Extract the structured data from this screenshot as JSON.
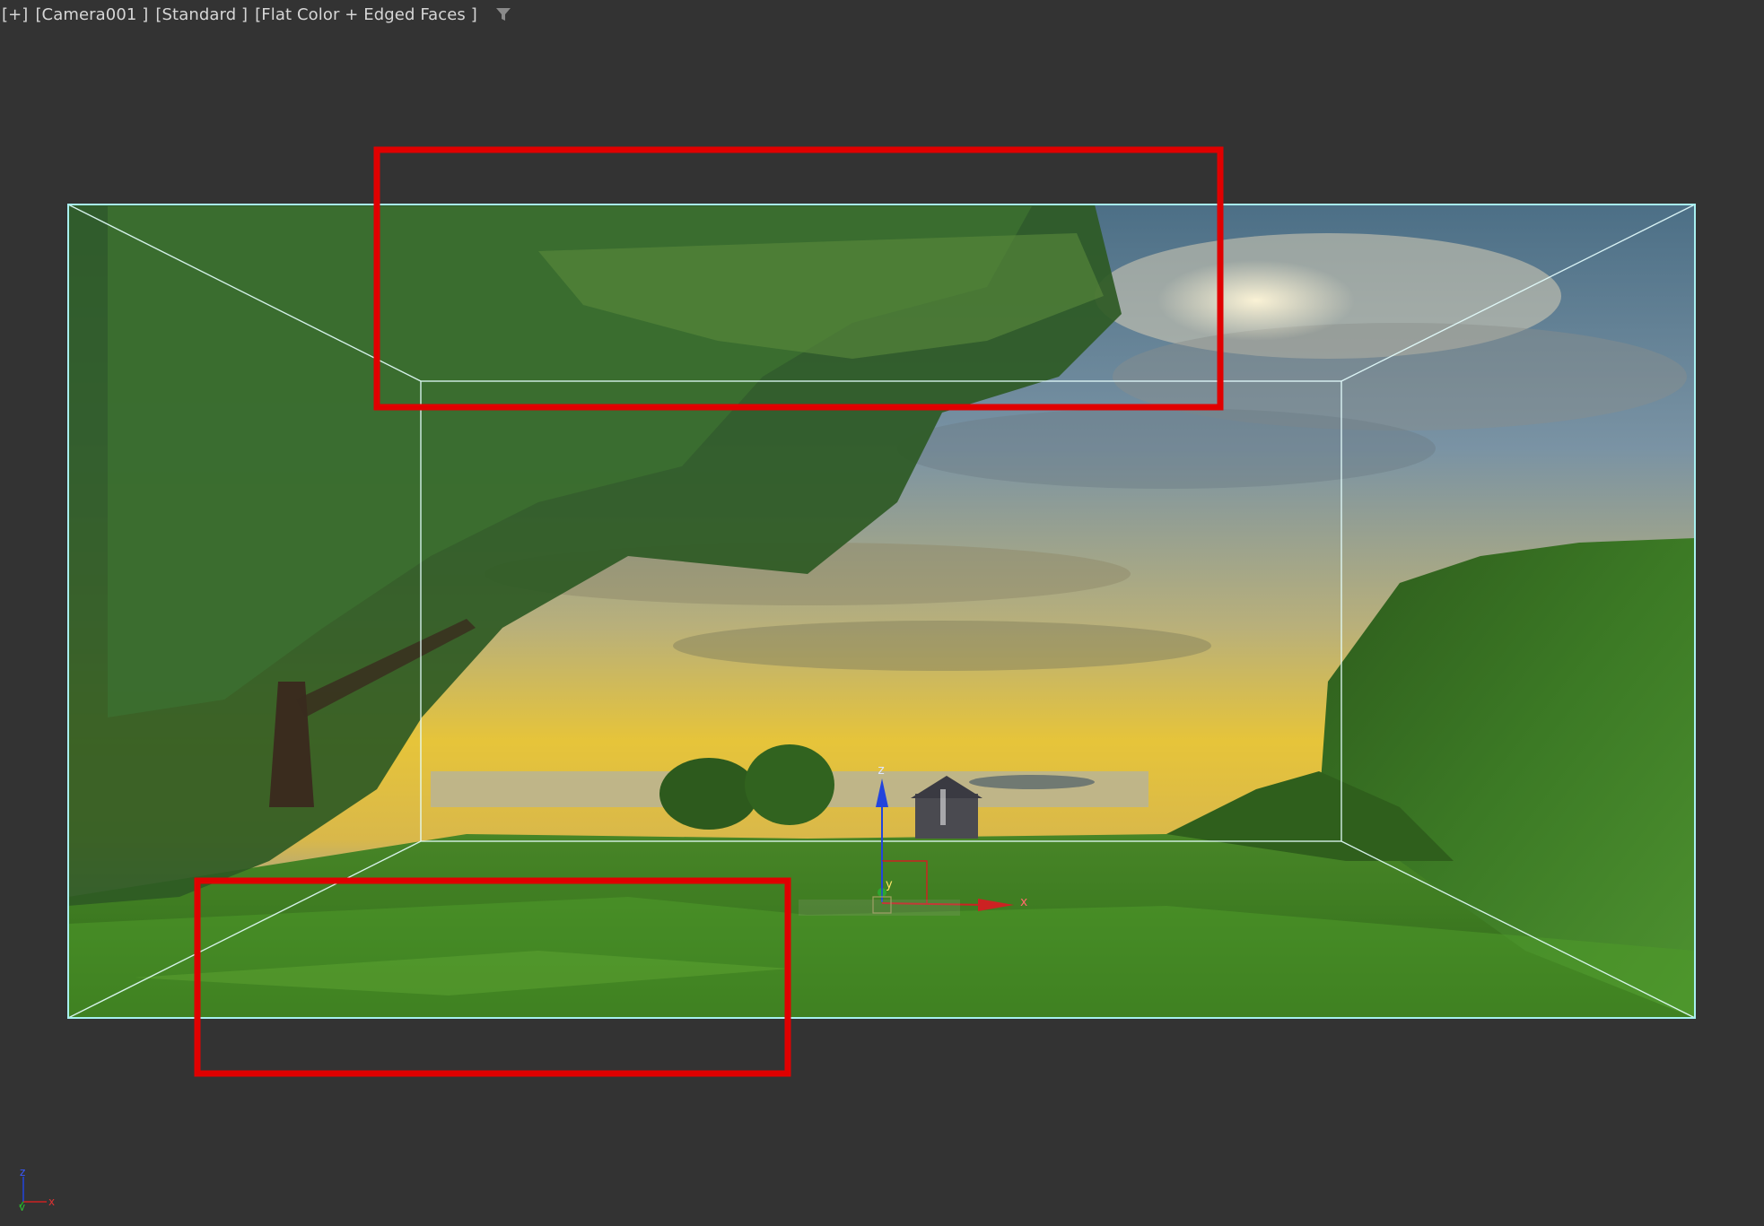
{
  "viewport": {
    "menu_label": "[+]",
    "camera_label": "[Camera001 ]",
    "shading_standard_label": "[Standard ]",
    "shading_mode_label": "[Flat Color + Edged Faces ]",
    "filter_icon": "funnel-icon"
  },
  "gizmo": {
    "x_label": "x",
    "y_label": "y",
    "z_label": "z"
  },
  "world_axis": {
    "x_label": "x",
    "y_label": "y",
    "z_label": "z"
  },
  "colors": {
    "background": "#333333",
    "box_edge": "#a8f0f0",
    "highlight": "#e00000",
    "axis_x": "#cc2222",
    "axis_y": "#22aa22",
    "axis_z": "#2244dd"
  }
}
